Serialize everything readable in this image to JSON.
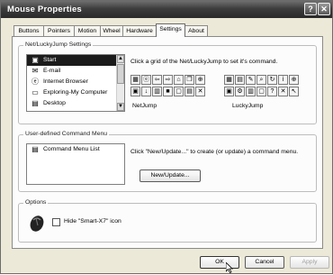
{
  "window": {
    "title": "Mouse Properties",
    "help_glyph": "?",
    "close_glyph": "✕"
  },
  "tabs": [
    "Buttons",
    "Pointers",
    "Motion",
    "Wheel",
    "Hardware",
    "Settings",
    "About"
  ],
  "active_tab": "Settings",
  "netjump": {
    "group_label": "Net/LuckyJump Settings",
    "items": [
      {
        "label": "Start",
        "icon": "start-icon",
        "selected": true
      },
      {
        "label": "E-mail",
        "icon": "email-icon",
        "selected": false
      },
      {
        "label": "Internet Browser",
        "icon": "internet-browser-icon",
        "selected": false
      },
      {
        "label": "Exploring-My Computer",
        "icon": "my-computer-icon",
        "selected": false
      },
      {
        "label": "Desktop",
        "icon": "desktop-icon",
        "selected": false
      }
    ],
    "instruction": "Click a grid of the Net/LuckyJump to set it's command.",
    "netjump_label": "NetJump",
    "luckyjump_label": "LuckyJump",
    "netjump_icons": [
      "grid-icon",
      "ie-icon",
      "back-arrow-icon",
      "forward-arrow-icon",
      "home-icon",
      "copy-icon",
      "plus-icon",
      "folder-icon",
      "down-arrow-icon",
      "panel-icon",
      "stop-icon",
      "window-icon",
      "save-icon",
      "close-x-icon"
    ],
    "luckyjump_icons": [
      "explorer-icon",
      "page-icon",
      "pen-icon",
      "search-icon",
      "refresh-icon",
      "info-icon",
      "plus-icon",
      "folder-icon",
      "settings-icon",
      "document-icon",
      "window-icon",
      "help-icon",
      "close-x-icon",
      "cursor-icon"
    ]
  },
  "user_menu": {
    "group_label": "User-defined Command Menu",
    "list_item": "Command Menu List",
    "instruction": "Click \"New/Update...\" to create (or update) a command menu.",
    "new_update_label": "New/Update..."
  },
  "options": {
    "group_label": "Options",
    "hide_icon_label": "Hide \"Smart-X7\" icon",
    "hide_icon_checked": false
  },
  "footer": {
    "ok_label": "OK",
    "cancel_label": "Cancel",
    "apply_label": "Apply"
  }
}
